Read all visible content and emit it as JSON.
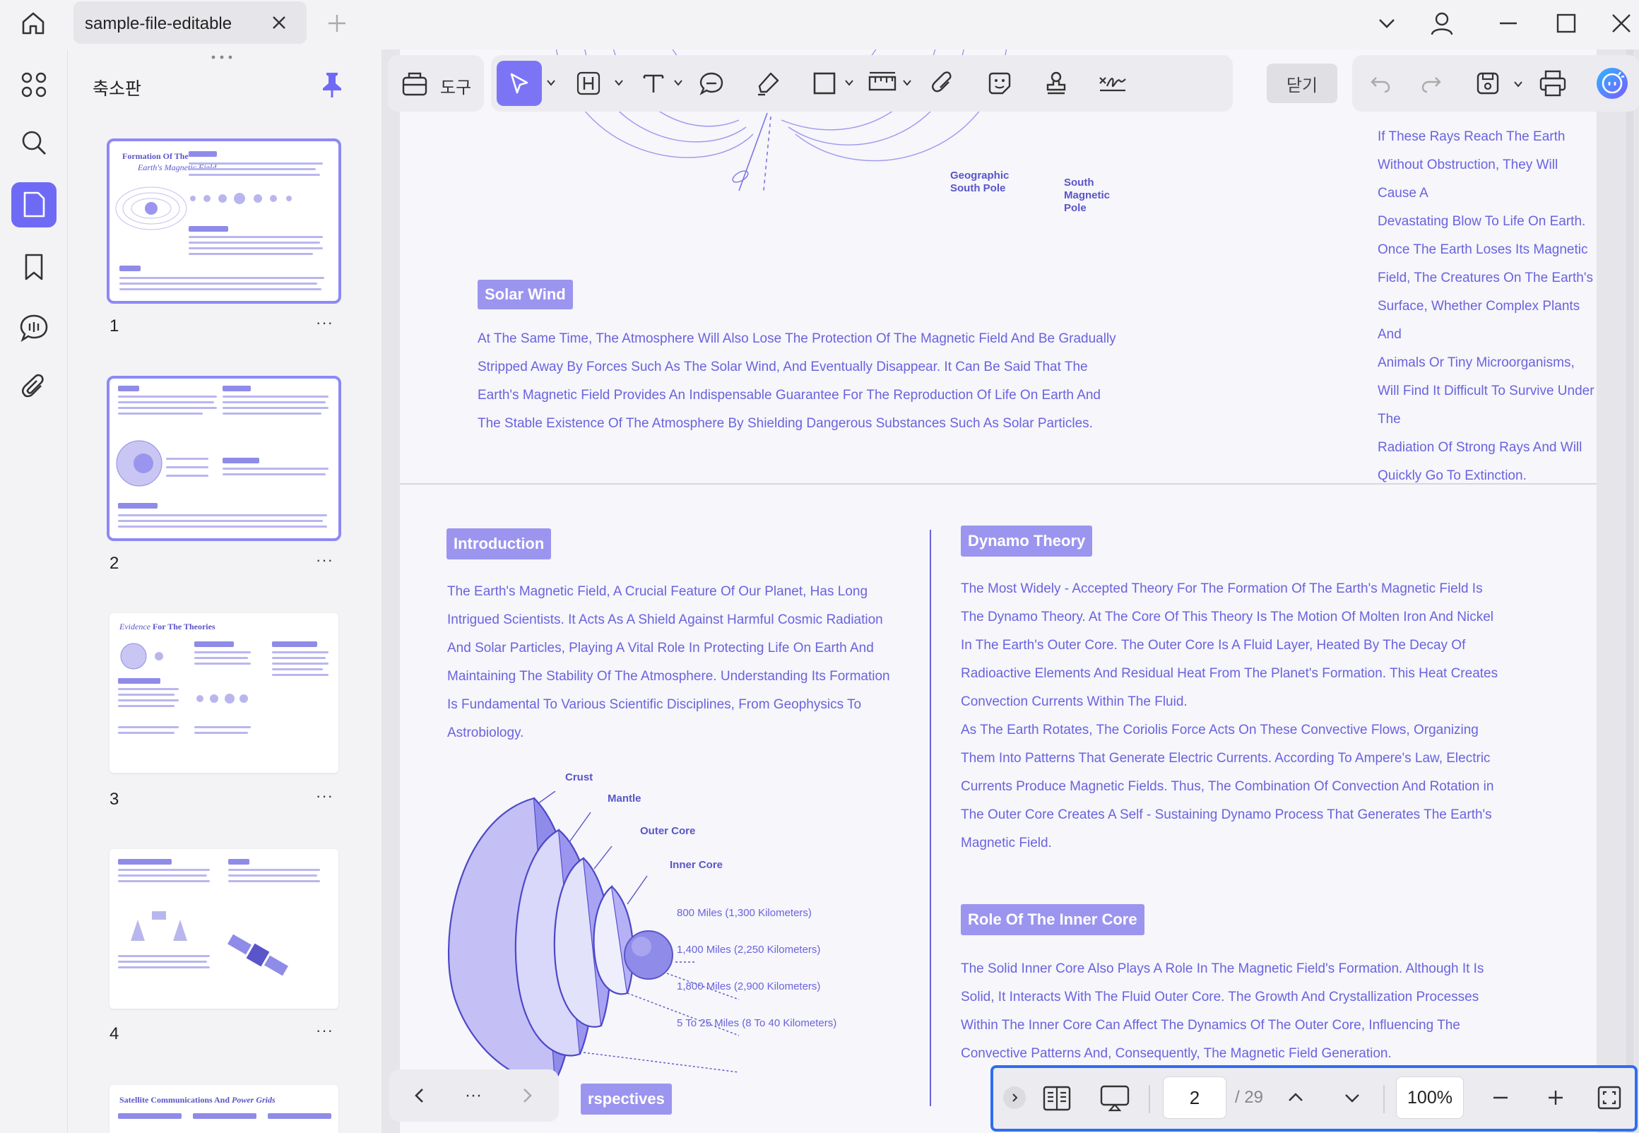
{
  "window": {
    "tab_title": "sample-file-editable"
  },
  "panel": {
    "title": "축소판",
    "thumbnails": [
      {
        "page": "1",
        "title_a": "Formation Of The",
        "title_b": "Earth's Magnetic Field"
      },
      {
        "page": "2"
      },
      {
        "page": "3",
        "title_a": "Evidence",
        "title_b": "For The Theories"
      },
      {
        "page": "4"
      },
      {
        "page": "",
        "title_a": "Satellite Communications And",
        "title_b": "Power Grids"
      }
    ],
    "more_glyph": "···"
  },
  "toolbar": {
    "tools_label": "도구",
    "close_label": "닫기"
  },
  "document": {
    "top_diagram_labels": {
      "geo_south": "Geographic\nSouth Pole",
      "south_mag": "South\nMagnetic\nPole"
    },
    "rays_paragraph": [
      "If These Rays Reach The Earth Without Obstruction, They Will Cause A",
      "Devastating Blow To Life On Earth. Once The Earth Loses Its Magnetic",
      "Field, The Creatures On The Earth's Surface, Whether Complex Plants And",
      "Animals Or Tiny Microorganisms, Will Find It Difficult To Survive Under The",
      "Radiation Of Strong Rays And Will Quickly Go To Extinction."
    ],
    "solar_wind_heading": "Solar Wind",
    "solar_wind_paragraph": [
      "At The Same Time, The Atmosphere Will Also Lose The Protection Of The Magnetic Field And Be Gradually",
      "Stripped Away By Forces Such As The Solar Wind, And Eventually Disappear. It Can Be Said That The",
      "Earth's Magnetic Field Provides An Indispensable Guarantee For The Reproduction Of Life On Earth And",
      "The Stable Existence Of The Atmosphere By Shielding Dangerous Substances Such As Solar Particles."
    ],
    "intro_heading": "Introduction",
    "intro_paragraph": [
      "The Earth's Magnetic Field, A Crucial Feature Of Our Planet, Has Long",
      "Intrigued Scientists. It Acts As A Shield Against Harmful Cosmic Radiation",
      "And Solar Particles, Playing A Vital Role In Protecting Life On Earth And",
      "Maintaining The Stability Of The Atmosphere. Understanding Its Formation",
      "Is Fundamental To Various Scientific Disciplines, From Geophysics To",
      "Astrobiology."
    ],
    "earth_layers": {
      "crust": "Crust",
      "mantle": "Mantle",
      "outer_core": "Outer Core",
      "inner_core": "Inner Core",
      "d1": "800 Miles (1,300 Kilometers)",
      "d2": "1,400 Miles (2,250 Kilometers)",
      "d3": "1,800 Miles (2,900 Kilometers)",
      "d4": "5 To 25 Miles (8 To 40 Kilometers)"
    },
    "dynamo_heading": "Dynamo Theory",
    "dynamo_paragraph": [
      "The Most Widely - Accepted Theory For The Formation Of The Earth's Magnetic Field Is",
      "The Dynamo Theory. At The Core Of This Theory Is The Motion Of Molten Iron And Nickel",
      "In The Earth's Outer Core. The Outer Core Is A Fluid Layer, Heated By The Decay Of",
      "Radioactive Elements And Residual Heat From The Planet's Formation. This Heat Creates",
      "Convection Currents Within The Fluid.",
      "As The Earth Rotates, The Coriolis Force Acts On These Convective Flows, Organizing",
      "Them Into Patterns That Generate Electric Currents. According To Ampere's Law, Electric",
      "Currents Produce Magnetic Fields. Thus, The Combination Of Convection And Rotation in",
      "The Outer Core Creates A Self - Sustaining Dynamo Process That Generates The Earth's",
      "Magnetic Field."
    ],
    "inner_core_heading": "Role Of The Inner Core",
    "inner_core_paragraph": [
      "The Solid Inner Core Also Plays A Role In The Magnetic Field's Formation. Although It Is",
      "Solid, It Interacts With The Fluid Outer Core. The Growth And Crystallization Processes",
      "Within The Inner Core Can Affect The Dynamics Of The Outer Core, Influencing The",
      "Convective Patterns And, Consequently, The Magnetic Field Generation."
    ],
    "partial_heading": "rspectives"
  },
  "navigation": {
    "current_page": "2",
    "total_pages": "/ 29",
    "zoom": "100%",
    "more_glyph": "···"
  },
  "colors": {
    "accent": "#6f6af5",
    "doc_text": "#6a63de",
    "tag_bg": "#9b95ef",
    "focus_border": "#2f6df0"
  }
}
